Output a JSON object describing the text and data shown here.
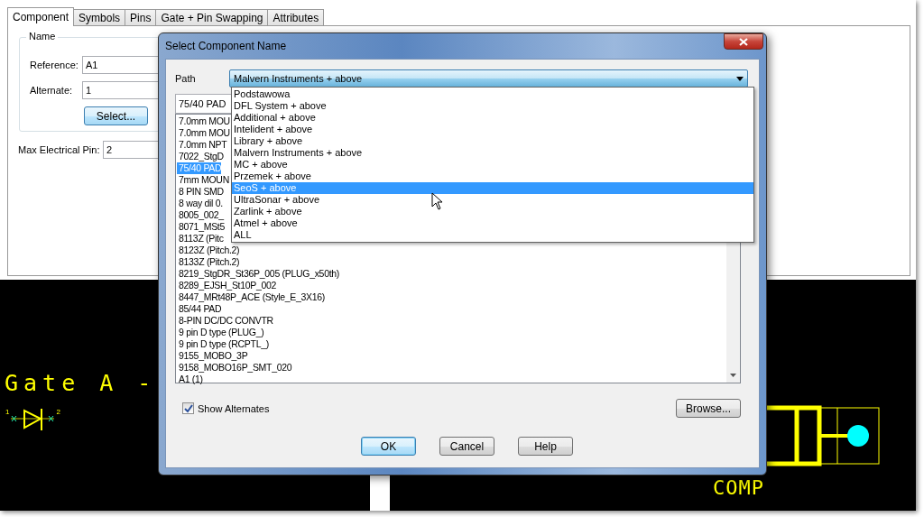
{
  "app": {
    "tabs": [
      {
        "label": "Component",
        "selected": true
      },
      {
        "label": "Symbols",
        "selected": false
      },
      {
        "label": "Pins",
        "selected": false
      },
      {
        "label": "Gate + Pin Swapping",
        "selected": false
      },
      {
        "label": "Attributes",
        "selected": false
      }
    ],
    "name_group": {
      "title": "Name",
      "reference_label": "Reference:",
      "reference": "A1",
      "alternate_label": "Alternate:",
      "alternate": "1",
      "select_button": "Select..."
    },
    "max_pin_label": "Max Electrical Pin:",
    "max_pin": "2"
  },
  "canvas": {
    "gate_label": "Gate A -",
    "pin_1": "1",
    "pin_2": "2",
    "comp_label": "COMP"
  },
  "dialog": {
    "title": "Select Component Name",
    "path_label": "Path",
    "path_value": "Malvern Instruments + above",
    "path_options": [
      {
        "label": "Podstawowa",
        "selected": false
      },
      {
        "label": "DFL System + above",
        "selected": false
      },
      {
        "label": "Additional + above",
        "selected": false
      },
      {
        "label": "Intelident + above",
        "selected": false
      },
      {
        "label": "Library + above",
        "selected": false
      },
      {
        "label": "Malvern Instruments + above",
        "selected": false
      },
      {
        "label": "MC + above",
        "selected": false
      },
      {
        "label": "Przemek + above",
        "selected": false
      },
      {
        "label": "SeoS + above",
        "selected": true
      },
      {
        "label": "UltraSonar + above",
        "selected": false
      },
      {
        "label": "Zarlink + above",
        "selected": false
      },
      {
        "label": "Atmel + above",
        "selected": false
      },
      {
        "label": "ALL",
        "selected": false
      }
    ],
    "component_field": "75/40 PAD",
    "components": [
      {
        "label": "7.0mm MOU",
        "selected": false
      },
      {
        "label": "7.0mm MOU",
        "selected": false
      },
      {
        "label": "7.0mm NPT",
        "selected": false
      },
      {
        "label": "7022_StgD",
        "selected": false
      },
      {
        "label": "75/40 PAD",
        "selected": true
      },
      {
        "label": "7mm MOUN",
        "selected": false
      },
      {
        "label": "8 PIN SMD",
        "selected": false
      },
      {
        "label": "8 way dil 0.",
        "selected": false
      },
      {
        "label": "8005_002_",
        "selected": false
      },
      {
        "label": "8071_MSt5",
        "selected": false
      },
      {
        "label": "8113Z (Pitc",
        "selected": false
      },
      {
        "label": "8123Z (Pitch.2)",
        "selected": false
      },
      {
        "label": "8133Z (Pitch.2)",
        "selected": false
      },
      {
        "label": "8219_StgDR_St36P_005 (PLUG_x50th)",
        "selected": false
      },
      {
        "label": "8289_EJSH_St10P_002",
        "selected": false
      },
      {
        "label": "8447_MRt48P_ACE (Style_E_3X16)",
        "selected": false
      },
      {
        "label": "85/44 PAD",
        "selected": false
      },
      {
        "label": "8-PIN DC/DC CONVTR",
        "selected": false
      },
      {
        "label": "9 pin D type (PLUG_)",
        "selected": false
      },
      {
        "label": "9 pin D type (RCPTL_)",
        "selected": false
      },
      {
        "label": "9155_MOBO_3P",
        "selected": false
      },
      {
        "label": "9158_MOBO16P_SMT_020",
        "selected": false
      },
      {
        "label": "A1 (1)",
        "selected": false
      }
    ],
    "show_alternates": {
      "label": "Show Alternates",
      "checked": true
    },
    "browse_button": "Browse...",
    "buttons": [
      {
        "label": "OK",
        "default": true
      },
      {
        "label": "Cancel",
        "default": false
      },
      {
        "label": "Help",
        "default": false
      }
    ]
  }
}
